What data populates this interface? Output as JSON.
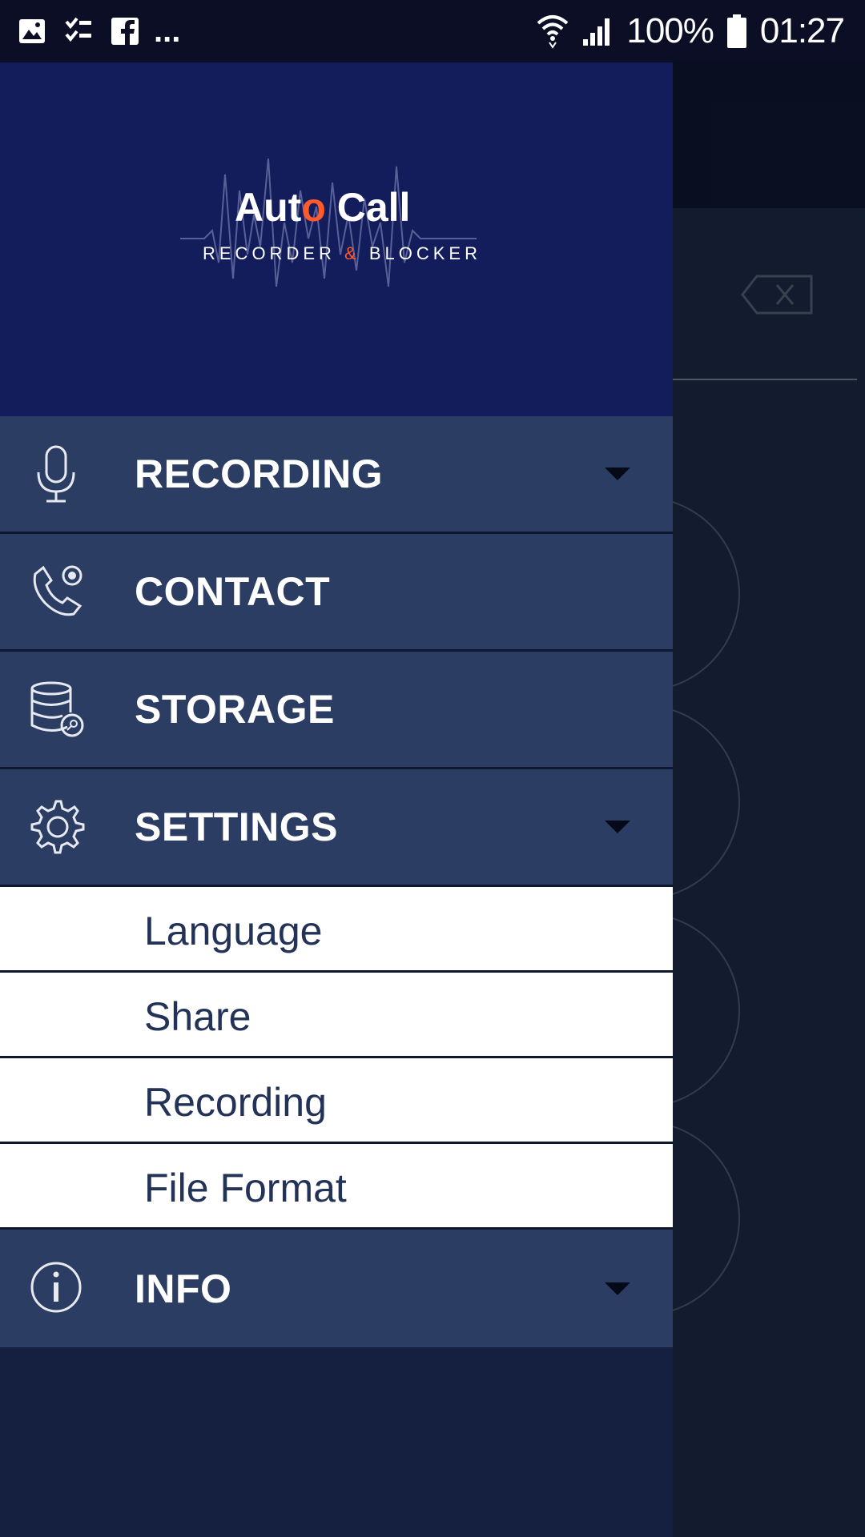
{
  "status_bar": {
    "icons_left": [
      "gallery-icon",
      "checklist-icon",
      "facebook-icon"
    ],
    "overflow": "...",
    "battery": "100%",
    "time": "01:27"
  },
  "logo": {
    "title_part1": "Aut",
    "title_o": "o",
    "title_part2": " Call",
    "subtitle_part1": "RECORDER ",
    "subtitle_amp": "&",
    "subtitle_part2": " BLOCKER",
    "colors": {
      "accent": "#ff5a2a",
      "header_bg": "#141d5c"
    }
  },
  "menu": {
    "recording": {
      "label": "RECORDING",
      "icon": "microphone-icon"
    },
    "contact": {
      "label": "CONTACT",
      "icon": "phone-contact-icon"
    },
    "storage": {
      "label": "STORAGE",
      "icon": "database-icon"
    },
    "settings": {
      "label": "SETTINGS",
      "icon": "gear-icon",
      "sub_items": [
        "Language",
        "Share",
        "Recording",
        "File Format"
      ]
    },
    "info": {
      "label": "INFO",
      "icon": "info-icon"
    }
  },
  "colors": {
    "menu_bg": "#2c3d64",
    "sub_text": "#233257"
  }
}
